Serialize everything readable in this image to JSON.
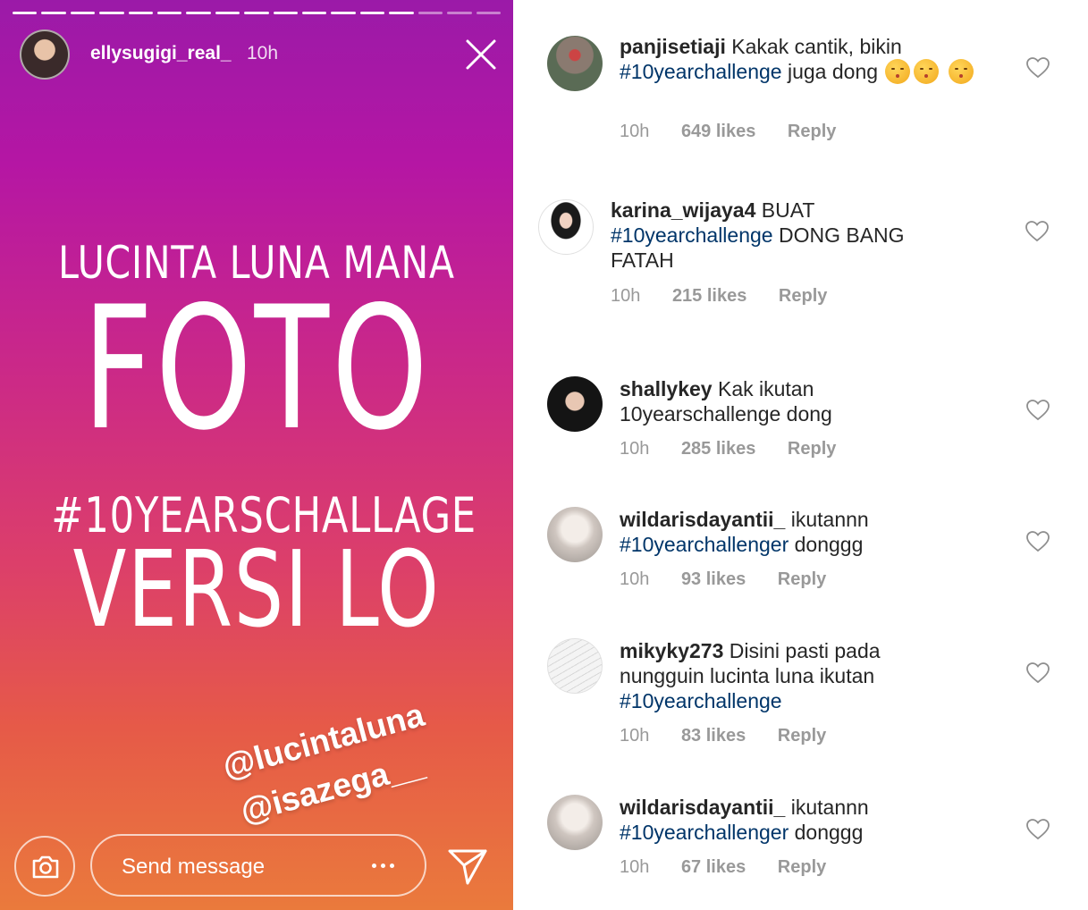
{
  "story": {
    "username": "ellysugigi_real_",
    "time": "10h",
    "progress_total": 17,
    "progress_filled": 14,
    "line1": "LUCINTA LUNA MANA",
    "line2": "FOTO",
    "line3": "#10YEARSCHALLAGE",
    "line4": "VERSI LO",
    "mentions": [
      "@lucintaluna",
      "@isazega__"
    ],
    "message_placeholder": "Send message",
    "icons": {
      "close": "close-icon",
      "camera": "camera-icon",
      "more": "more-icon",
      "send": "send-icon"
    }
  },
  "comments": [
    {
      "username": "panjisetiaji",
      "text_before": "Kakak cantik, bikin",
      "hashtag": "#10yearchallenge",
      "text_after": "juga dong",
      "emoji_count": 3,
      "time": "10h",
      "likes": "649 likes",
      "reply": "Reply"
    },
    {
      "username": "karina_wijaya4",
      "text_before": "BUAT",
      "hashtag": "#10yearchallenge",
      "text_after": "DONG BANG FATAH",
      "time": "10h",
      "likes": "215 likes",
      "reply": "Reply"
    },
    {
      "username": "shallykey",
      "text_before": "Kak ikutan 10yearschallenge dong",
      "time": "10h",
      "likes": "285 likes",
      "reply": "Reply"
    },
    {
      "username": "wildarisdayantii_",
      "text_before": "ikutannn",
      "hashtag": "#10yearchallenger",
      "text_after": "donggg",
      "time": "10h",
      "likes": "93 likes",
      "reply": "Reply"
    },
    {
      "username": "mikyky273",
      "text_before": "Disini pasti pada nungguin lucinta luna ikutan",
      "hashtag": "#10yearchallenge",
      "text_after": "",
      "time": "10h",
      "likes": "83 likes",
      "reply": "Reply"
    },
    {
      "username": "wildarisdayantii_",
      "text_before": "ikutannn",
      "hashtag": "#10yearchallenger",
      "text_after": "donggg",
      "time": "10h",
      "likes": "67 likes",
      "reply": "Reply"
    }
  ],
  "colors": {
    "hashtag": "#003569",
    "meta": "#999999",
    "text": "#262626"
  }
}
